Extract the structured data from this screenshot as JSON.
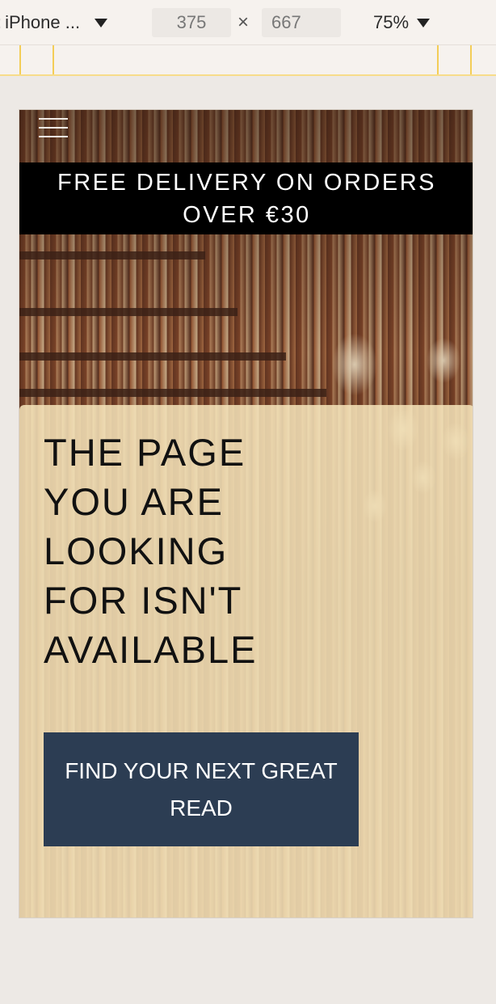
{
  "devtools": {
    "device_label": "iPhone ...",
    "width_value": "375",
    "times_glyph": "×",
    "height_value": "667",
    "zoom_label": "75%"
  },
  "page": {
    "promo_banner": "FREE DELIVERY ON ORDERS OVER €30",
    "headline": "THE PAGE YOU ARE LOOKING FOR ISN'T AVAILABLE",
    "cta_label": "FIND YOUR NEXT GREAT READ"
  },
  "colors": {
    "banner_bg": "#000000",
    "card_bg": "#f6e4ba",
    "cta_bg": "#2c3d53",
    "ruler_accent": "#f3cd57"
  },
  "icons": [
    "hamburger-menu-icon",
    "dropdown-caret-icon"
  ]
}
